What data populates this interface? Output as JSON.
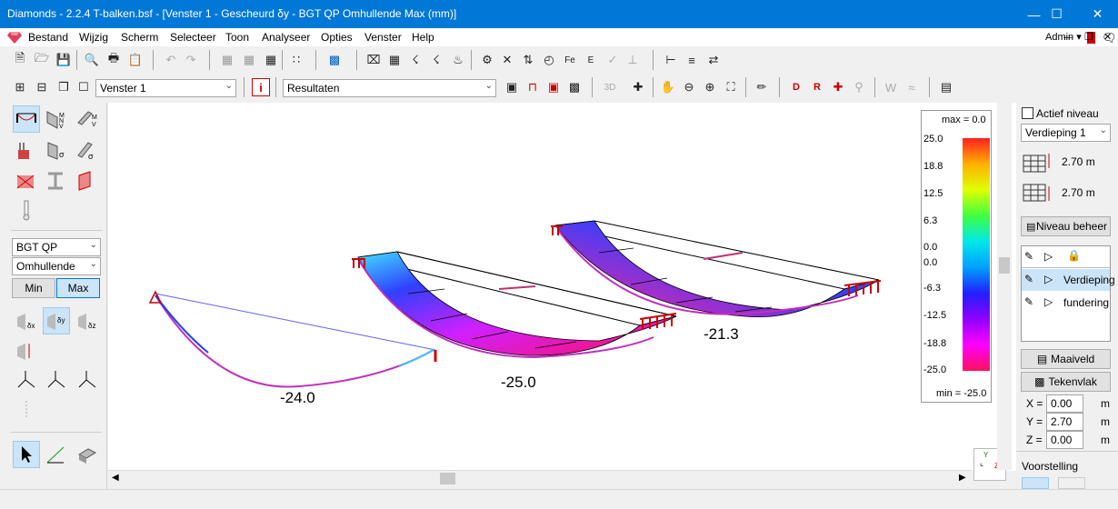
{
  "window": {
    "title": "Diamonds  -  2.2.4 T-balken.bsf - [Venster 1 - Gescheurd δy - BGT QP Omhullende Max  (mm)]",
    "minimize": "—",
    "maximize": "☐",
    "close": "✕"
  },
  "menu": {
    "items": [
      "Bestand",
      "Wijzig",
      "Scherm",
      "Selecteer",
      "Toon",
      "Analyseer",
      "Opties",
      "Venster",
      "Help"
    ],
    "user": "Admin ▾"
  },
  "toolbar": {
    "window_select": "Venster 1",
    "results_select": "Resultaten",
    "info": "i"
  },
  "left_panel": {
    "load_combo": "BGT QP",
    "envelope_combo": "Omhullende",
    "min_label": "Min",
    "max_label": "Max"
  },
  "legend": {
    "max_label": "max = 0.0",
    "min_label": "min = -25.0",
    "ticks": [
      "25.0",
      "18.8",
      "12.5",
      "6.3",
      "0.0",
      "0.0",
      "-6.3",
      "-12.5",
      "-18.8",
      "-25.0"
    ]
  },
  "diagram": {
    "labels": [
      "-24.0",
      "-25.0",
      "-21.3"
    ]
  },
  "right_panel": {
    "active_level_label": "Actief niveau",
    "level_select": "Verdieping 1",
    "height_above": "2.70 m",
    "height_below": "2.70 m",
    "level_manage": "Niveau beheer",
    "layers": [
      "Verdieping",
      "fundering"
    ],
    "ground_button": "Maaiveld",
    "drawing_plane_button": "Tekenvlak",
    "coords": [
      {
        "axis": "X =",
        "value": "0.00",
        "unit": "m"
      },
      {
        "axis": "Y =",
        "value": "2.70",
        "unit": "m"
      },
      {
        "axis": "Z =",
        "value": "0.00",
        "unit": "m"
      }
    ],
    "representation": "Voorstelling"
  },
  "colors": {
    "titlebar": "#0078d7",
    "accent": "#cc0000"
  }
}
